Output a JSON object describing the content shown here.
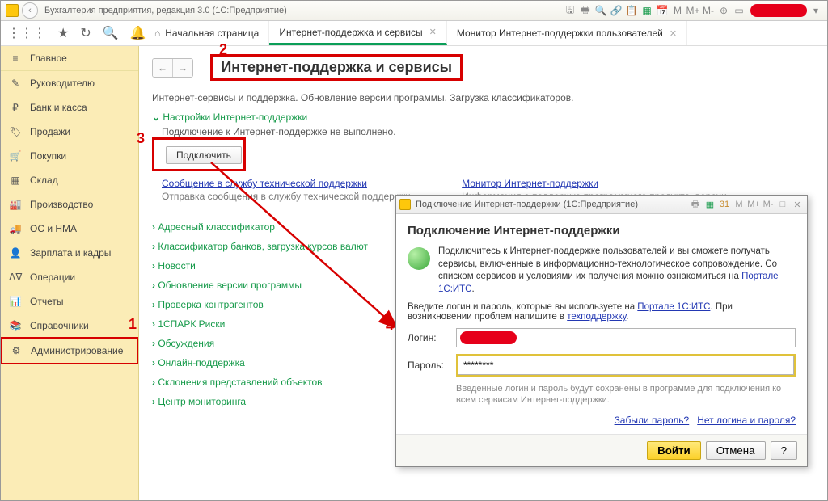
{
  "titlebar": {
    "text": "Бухгалтерия предприятия, редакция 3.0  (1С:Предприятие)",
    "mm_labels": [
      "M",
      "M+",
      "M-"
    ]
  },
  "tabs": {
    "home": "Начальная страница",
    "t1": "Интернет-поддержка и сервисы",
    "t2": "Монитор Интернет-поддержки пользователей"
  },
  "sidebar": {
    "items": [
      {
        "icon": "≡",
        "label": "Главное"
      },
      {
        "icon": "✎",
        "label": "Руководителю"
      },
      {
        "icon": "₽",
        "label": "Банк и касса"
      },
      {
        "icon": "🏷",
        "label": "Продажи"
      },
      {
        "icon": "🛒",
        "label": "Покупки"
      },
      {
        "icon": "▦",
        "label": "Склад"
      },
      {
        "icon": "🏭",
        "label": "Производство"
      },
      {
        "icon": "🚚",
        "label": "ОС и НМА"
      },
      {
        "icon": "👤",
        "label": "Зарплата и кадры"
      },
      {
        "icon": "ᐃᐁ",
        "label": "Операции"
      },
      {
        "icon": "📊",
        "label": "Отчеты"
      },
      {
        "icon": "📚",
        "label": "Справочники"
      },
      {
        "icon": "⚙",
        "label": "Администрирование"
      }
    ]
  },
  "page": {
    "title": "Интернет-поддержка и сервисы",
    "subtitle": "Интернет-сервисы и поддержка. Обновление версии программы. Загрузка классификаторов.",
    "sec_settings": "Настройки Интернет-поддержки",
    "conn_status": "Подключение к Интернет-поддержке не выполнено.",
    "connect_btn": "Подключить",
    "link_support": "Сообщение в службу технической поддержки",
    "link_support_desc": "Отправка сообщения в службу технической поддержки.",
    "link_monitor": "Монитор Интернет-поддержки",
    "link_monitor_desc": "Информация о поддержке программного продукта, версии программы и др.",
    "sections": [
      "Адресный классификатор",
      "Классификатор банков, загрузка курсов валют",
      "Новости",
      "Обновление версии программы",
      "Проверка контрагентов",
      "1СПАРК Риски",
      "Обсуждения",
      "Онлайн-поддержка",
      "Склонения представлений объектов",
      "Центр мониторинга"
    ]
  },
  "dialog": {
    "title": "Подключение Интернет-поддержки  (1С:Предприятие)",
    "heading": "Подключение Интернет-поддержки",
    "intro_a": "Подключитесь к Интернет-поддержке пользователей и вы сможете получать сервисы, включенные в информационно-технологическое сопровождение. Со списком сервисов и условиями их получения можно ознакомиться на ",
    "intro_link1": "Портале 1С:ИТС",
    "intro_b1": "Введите логин и пароль, которые вы используете на ",
    "intro_link2": "Портале 1С:ИТС",
    "intro_b2": ". При возникновении проблем напишите в ",
    "intro_link3": "техподдержку",
    "login_label": "Логин:",
    "password_label": "Пароль:",
    "password_value": "********",
    "hint": "Введенные логин и пароль будут сохранены в программе для подключения ко всем сервисам Интернет-поддержки.",
    "forgot": "Забыли пароль?",
    "nologin": "Нет логина и пароля?",
    "btn_login": "Войти",
    "btn_cancel": "Отмена",
    "btn_help": "?"
  },
  "annotations": {
    "n1": "1",
    "n2": "2",
    "n3": "3",
    "n4": "4"
  }
}
